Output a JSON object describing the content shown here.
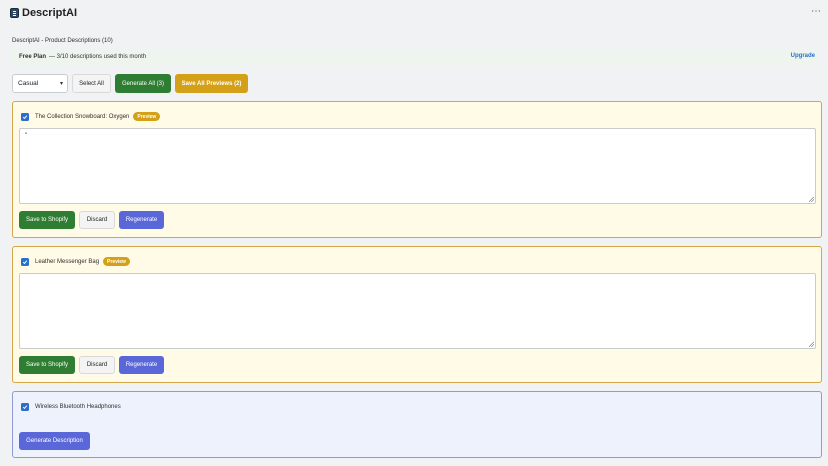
{
  "app": {
    "title": "DescriptAI"
  },
  "page": {
    "heading": "DescriptAI - Product Descriptions (10)"
  },
  "plan": {
    "name": "Free Plan",
    "usage": "— 3/10 descriptions used this month",
    "upgrade_label": "Upgrade"
  },
  "toolbar": {
    "tone_selected": "Casual",
    "select_all_label": "Select All",
    "generate_all_label": "Generate All (3)",
    "save_all_label": "Save All Previews (2)"
  },
  "products": [
    {
      "name": "The Collection Snowboard: Oxygen",
      "badge": "Preview",
      "description": "\"",
      "save_label": "Save to Shopify",
      "discard_label": "Discard",
      "regenerate_label": "Regenerate"
    },
    {
      "name": "Leather Messenger Bag",
      "badge": "Preview",
      "description": "",
      "save_label": "Save to Shopify",
      "discard_label": "Discard",
      "regenerate_label": "Regenerate"
    },
    {
      "name": "Wireless Bluetooth Headphones",
      "generate_label": "Generate Description"
    }
  ],
  "colors": {
    "primary_green": "#2e7d32",
    "accent_gold": "#d4a017",
    "indigo": "#5a67d8",
    "link_blue": "#2c6ecb"
  }
}
